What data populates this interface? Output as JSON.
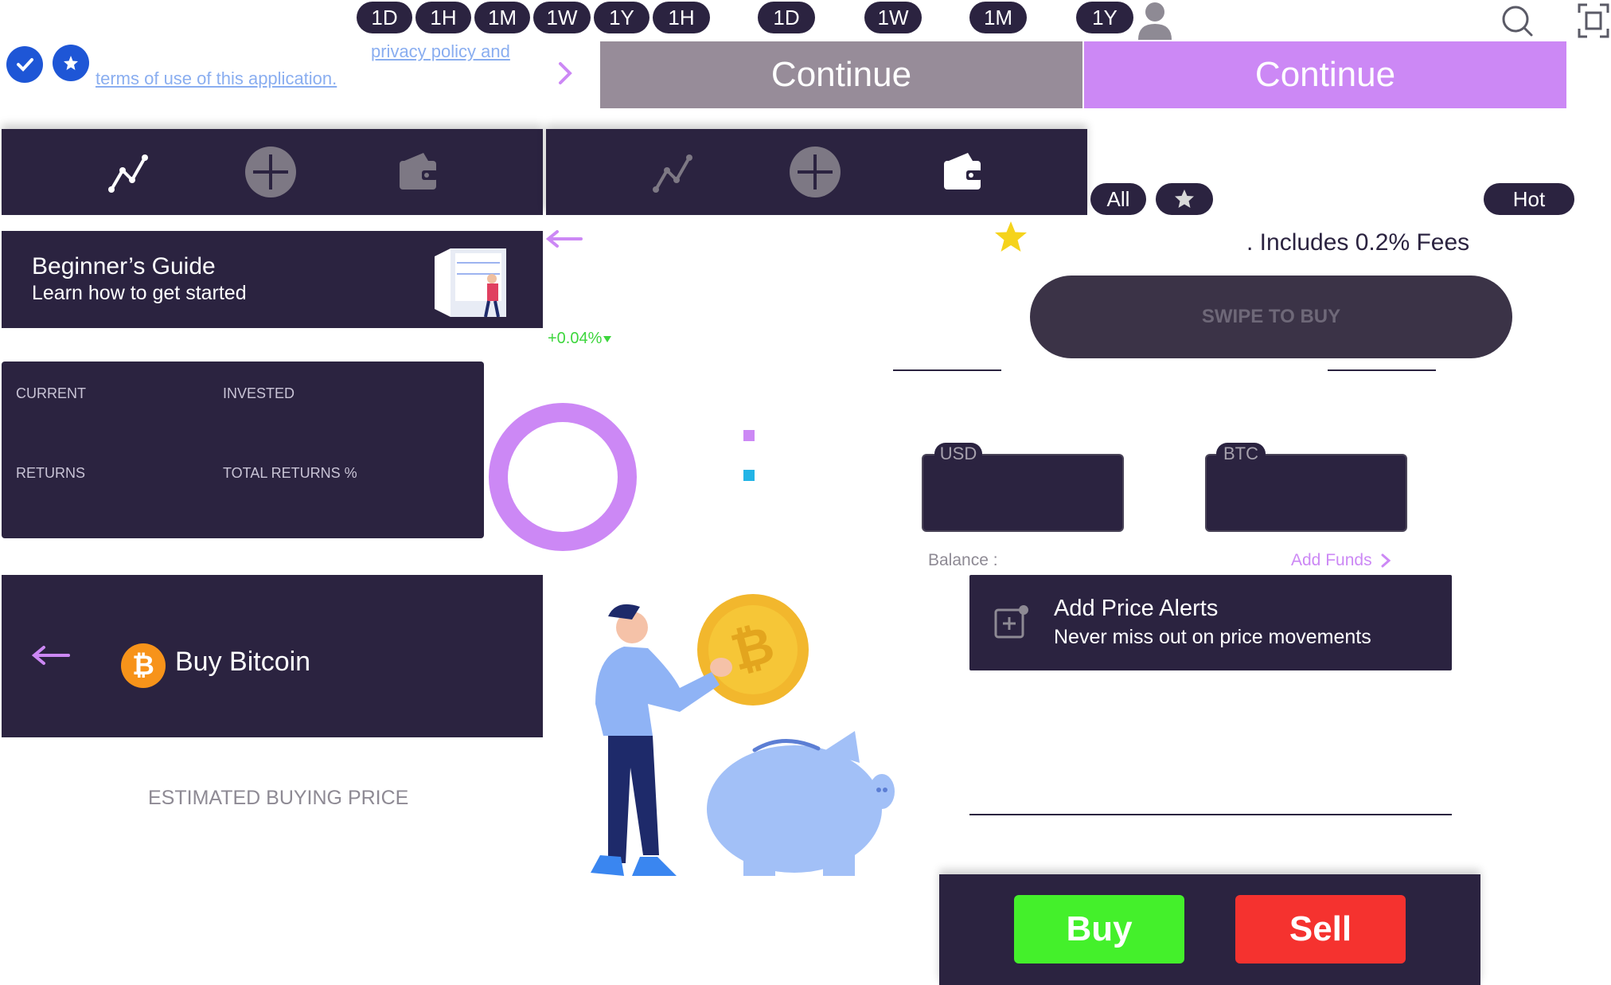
{
  "timeframes_group_a": [
    "1D",
    "1H",
    "1M",
    "1W",
    "1Y",
    "1H"
  ],
  "timeframes_group_b": [
    "1D",
    "1W",
    "1M",
    "1Y"
  ],
  "terms": {
    "privacy": "privacy policy and",
    "terms": "terms of use of this application."
  },
  "continue_buttons": {
    "disabled_label": "Continue",
    "enabled_label": "Continue"
  },
  "filters": {
    "all": "All",
    "hot": "Hot"
  },
  "fees_text": ". Includes 0.2% Fees",
  "swipe_label": "SWIPE TO BUY",
  "guide": {
    "title": "Beginner’s Guide",
    "subtitle": "Learn how to get started"
  },
  "change_percent": "+0.04%",
  "portfolio": {
    "current": "CURRENT",
    "invested": "INVESTED",
    "returns": "RETURNS",
    "total_returns": "TOTAL RETURNS %"
  },
  "currency": {
    "fiat": "USD",
    "crypto": "BTC"
  },
  "balance_label": "Balance :",
  "add_funds": "Add Funds",
  "alerts": {
    "title": "Add Price Alerts",
    "subtitle": "Never miss out on price movements"
  },
  "buy_header": {
    "title": "Buy Bitcoin",
    "coin_symbol": "₿"
  },
  "estimated_label": "ESTIMATED BUYING PRICE",
  "trade": {
    "buy": "Buy",
    "sell": "Sell"
  },
  "colors": {
    "dark": "#2b2340",
    "purple": "#cc88f5",
    "grey_button": "#978c99",
    "buy_green": "#44f02b",
    "sell_red": "#f5322f",
    "check_blue": "#1e56d6",
    "link_blue": "#8aaef0",
    "change_green": "#3dd63d"
  }
}
